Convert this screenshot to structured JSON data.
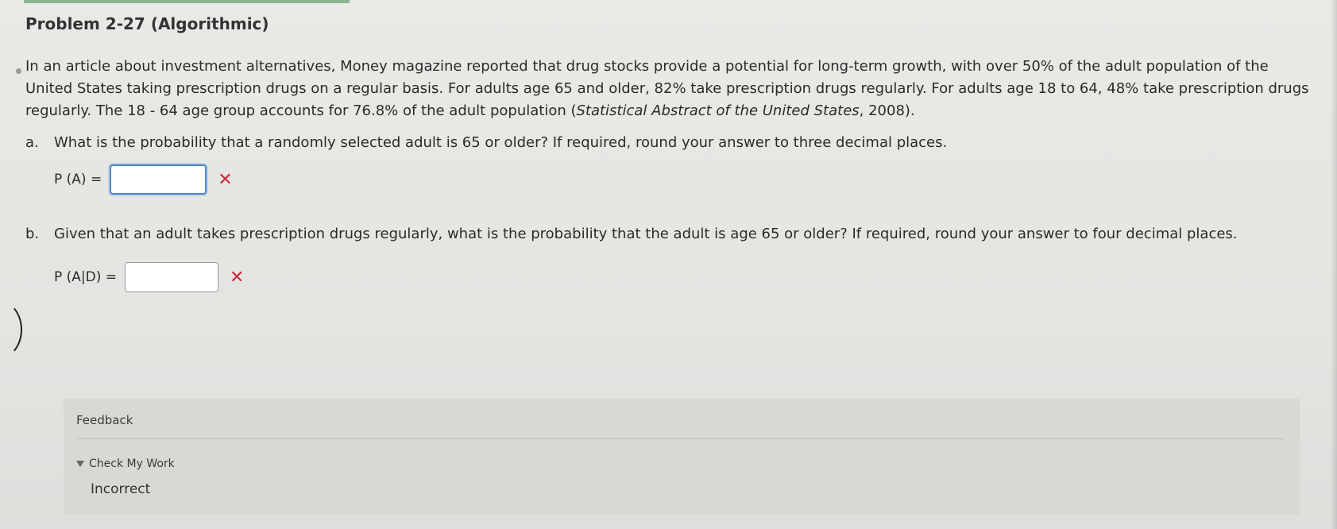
{
  "problem": {
    "title": "Problem 2-27 (Algorithmic)",
    "intro_before": "In an article about investment alternatives, Money magazine reported that drug stocks provide a potential for long-term growth, with over 50% of the adult population of the United States taking prescription drugs on a regular basis. For adults age 65 and older, 82% take prescription drugs regularly. For adults age 18 to 64, 48% take prescription drugs regularly. The 18 - 64 age group accounts for 76.8% of the adult population (",
    "intro_citation": "Statistical Abstract of the United States",
    "intro_after": ", 2008)."
  },
  "part_a": {
    "letter": "a.",
    "question": "What is the probability that a randomly selected adult is 65 or older? If required, round your answer to three decimal places.",
    "label": "P (A) =",
    "value": "",
    "result_mark": "✕"
  },
  "part_b": {
    "letter": "b.",
    "question": "Given that an adult takes prescription drugs regularly, what is the probability that the adult is age 65 or older? If required, round your answer to four decimal places.",
    "label": "P (A|D) =",
    "value": "",
    "result_mark": "✕"
  },
  "feedback": {
    "title": "Feedback",
    "check_label": "Check My Work",
    "status": "Incorrect"
  },
  "colors": {
    "wrong": "#d12a3a",
    "input_focus_border": "#4a86c7",
    "feedback_bg": "#d7d9d5"
  }
}
